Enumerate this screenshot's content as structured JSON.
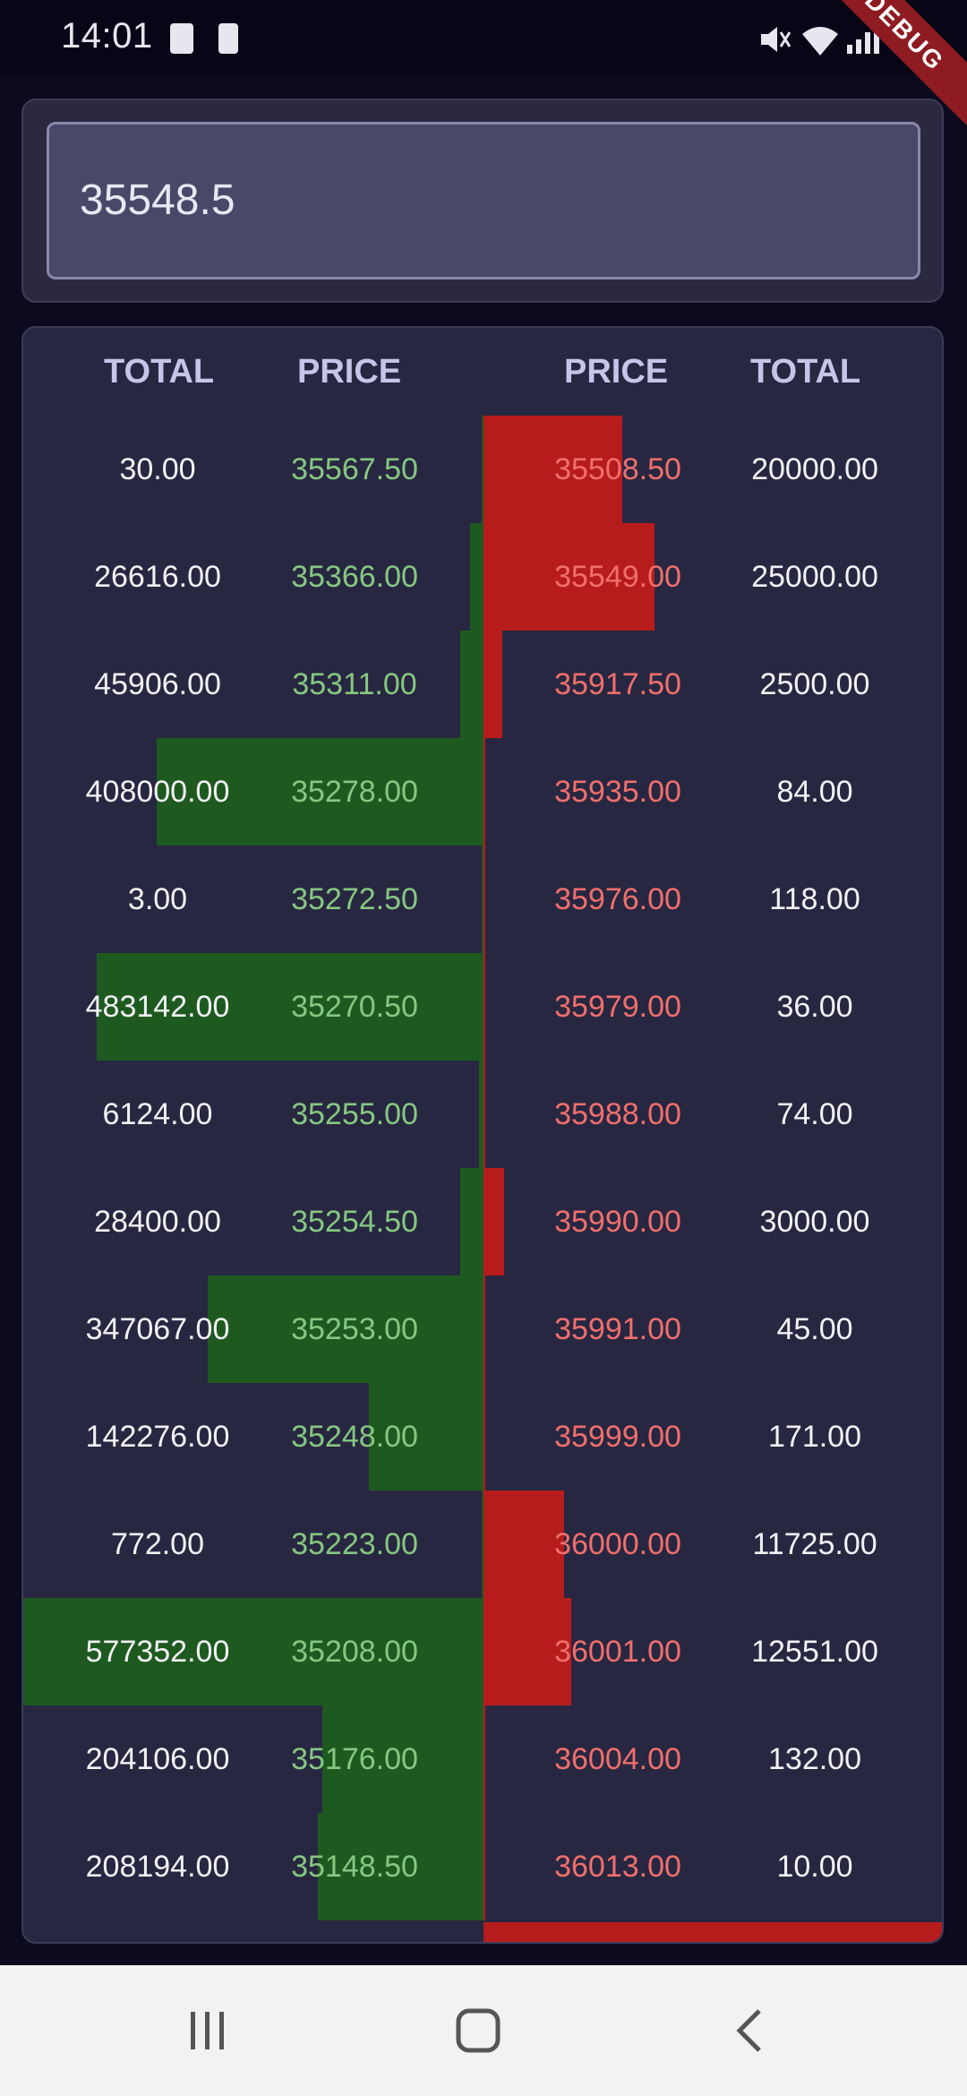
{
  "status_bar": {
    "time": "14:01",
    "debug_label": "DEBUG",
    "left_icons": [
      "check-box-icon",
      "battery-icon"
    ],
    "right_icons": [
      "mute-icon",
      "wifi-icon",
      "signal-icon",
      "battery-icon"
    ]
  },
  "search": {
    "value": "35548.5"
  },
  "headers": {
    "bid_total": "TOTAL",
    "bid_price": "PRICE",
    "ask_price": "PRICE",
    "ask_total": "TOTAL"
  },
  "rows": [
    {
      "bid_total": "30.00",
      "bid_price": "35567.50",
      "ask_price": "35508.50",
      "ask_total": "20000.00",
      "bid_depth": 0.0,
      "ask_depth": 0.3
    },
    {
      "bid_total": "26616.00",
      "bid_price": "35366.00",
      "ask_price": "35549.00",
      "ask_total": "25000.00",
      "bid_depth": 0.03,
      "ask_depth": 0.37
    },
    {
      "bid_total": "45906.00",
      "bid_price": "35311.00",
      "ask_price": "35917.50",
      "ask_total": "2500.00",
      "bid_depth": 0.05,
      "ask_depth": 0.04
    },
    {
      "bid_total": "408000.00",
      "bid_price": "35278.00",
      "ask_price": "35935.00",
      "ask_total": "84.00",
      "bid_depth": 0.71,
      "ask_depth": 0.0
    },
    {
      "bid_total": "3.00",
      "bid_price": "35272.50",
      "ask_price": "35976.00",
      "ask_total": "118.00",
      "bid_depth": 0.0,
      "ask_depth": 0.0
    },
    {
      "bid_total": "483142.00",
      "bid_price": "35270.50",
      "ask_price": "35979.00",
      "ask_total": "36.00",
      "bid_depth": 0.84,
      "ask_depth": 0.0
    },
    {
      "bid_total": "6124.00",
      "bid_price": "35255.00",
      "ask_price": "35988.00",
      "ask_total": "74.00",
      "bid_depth": 0.01,
      "ask_depth": 0.0
    },
    {
      "bid_total": "28400.00",
      "bid_price": "35254.50",
      "ask_price": "35990.00",
      "ask_total": "3000.00",
      "bid_depth": 0.05,
      "ask_depth": 0.045
    },
    {
      "bid_total": "347067.00",
      "bid_price": "35253.00",
      "ask_price": "35991.00",
      "ask_total": "45.00",
      "bid_depth": 0.6,
      "ask_depth": 0.0
    },
    {
      "bid_total": "142276.00",
      "bid_price": "35248.00",
      "ask_price": "35999.00",
      "ask_total": "171.00",
      "bid_depth": 0.25,
      "ask_depth": 0.0
    },
    {
      "bid_total": "772.00",
      "bid_price": "35223.00",
      "ask_price": "36000.00",
      "ask_total": "11725.00",
      "bid_depth": 0.0,
      "ask_depth": 0.175
    },
    {
      "bid_total": "577352.00",
      "bid_price": "35208.00",
      "ask_price": "36001.00",
      "ask_total": "12551.00",
      "bid_depth": 1.0,
      "ask_depth": 0.19
    },
    {
      "bid_total": "204106.00",
      "bid_price": "35176.00",
      "ask_price": "36004.00",
      "ask_total": "132.00",
      "bid_depth": 0.35,
      "ask_depth": 0.0
    },
    {
      "bid_total": "208194.00",
      "bid_price": "35148.50",
      "ask_price": "36013.00",
      "ask_total": "10.00",
      "bid_depth": 0.36,
      "ask_depth": 0.0
    }
  ],
  "colors": {
    "bid_bar": "#1e5a1f",
    "ask_bar": "#b71c1c",
    "bid_price": "#86c781",
    "ask_price": "#ef6f6c"
  },
  "nav": {
    "buttons": [
      "recent-apps-icon",
      "home-icon",
      "back-icon"
    ]
  }
}
